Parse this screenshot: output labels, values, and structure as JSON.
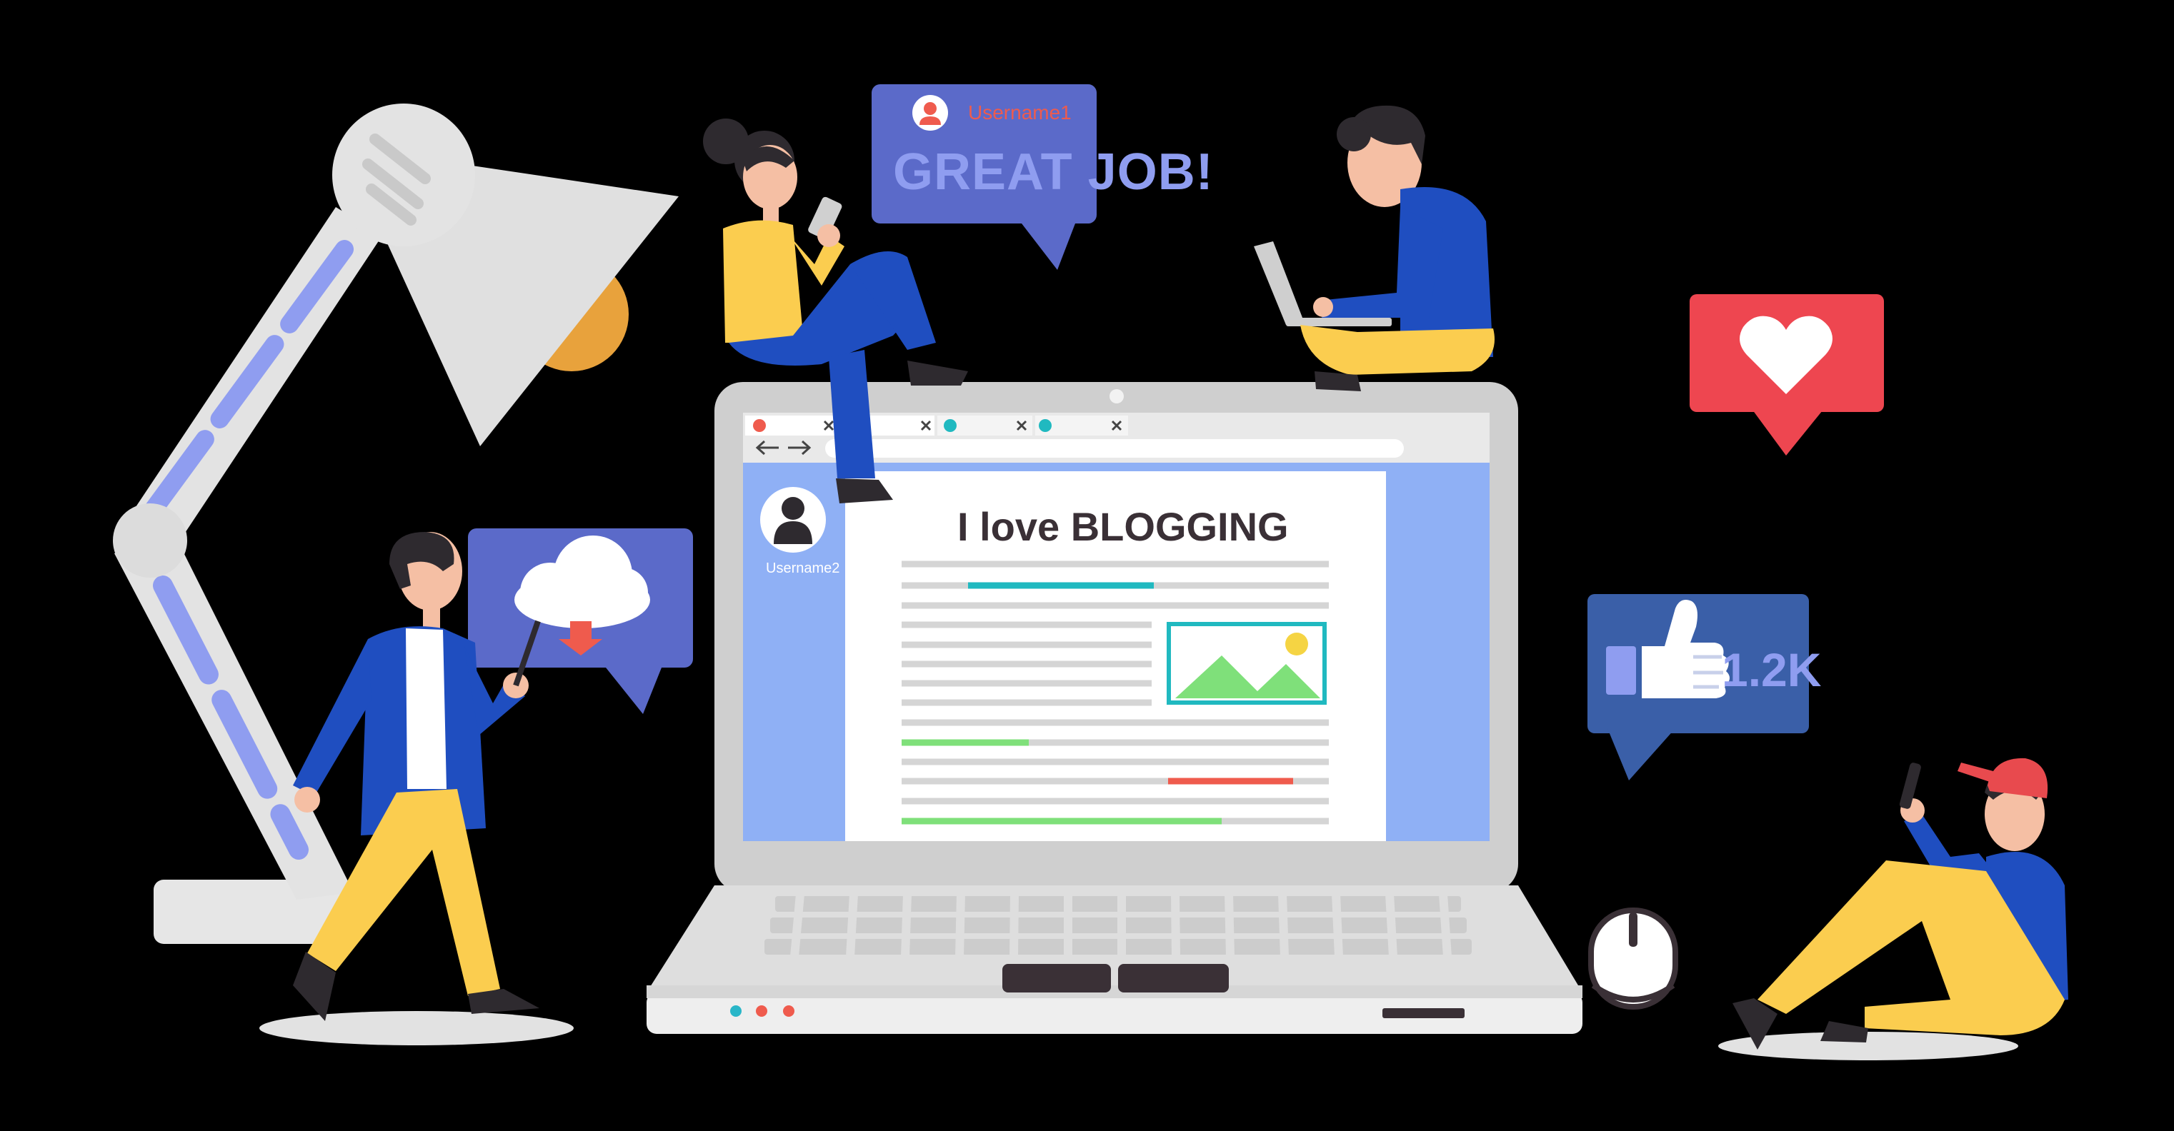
{
  "bubbles": {
    "comment": {
      "username": "Username1",
      "text": "GREAT JOB!",
      "icon": "user-avatar-icon"
    },
    "likes": {
      "count": "1.2K",
      "icon": "thumbs-up-icon"
    },
    "love": {
      "icon": "heart-icon"
    },
    "upload": {
      "icon": "cloud-download-icon"
    }
  },
  "browser": {
    "tabs": [
      {
        "icon": "close-icon"
      },
      {
        "icon": "close-icon"
      },
      {
        "icon": "close-icon"
      }
    ],
    "nav": {
      "back_icon": "arrow-left-icon",
      "forward_icon": "arrow-right-icon"
    },
    "sidebar": {
      "username": "Username2",
      "icon": "user-avatar-icon"
    },
    "post": {
      "title": "I love BLOGGING",
      "image_icon": "landscape-image-icon"
    }
  },
  "laptop": {
    "indicator_colors": [
      "#29b6c8",
      "#ef5b4d",
      "#ef5b4d"
    ]
  },
  "colors": {
    "background": "#000000",
    "bubble_purple": "#5b6ac9",
    "bubble_blue": "#3a5fa8",
    "heart_red": "#ee4650",
    "lamp_gray": "#e5e5e5",
    "lamp_accent": "#8f9df0",
    "screen_blue": "#8fb0f5",
    "shirt_yellow": "#fbcd4f",
    "jacket_blue": "#1f4ec0",
    "accent_teal": "#20b9c0",
    "accent_green": "#7fe07a",
    "accent_red": "#ef5b4d"
  }
}
